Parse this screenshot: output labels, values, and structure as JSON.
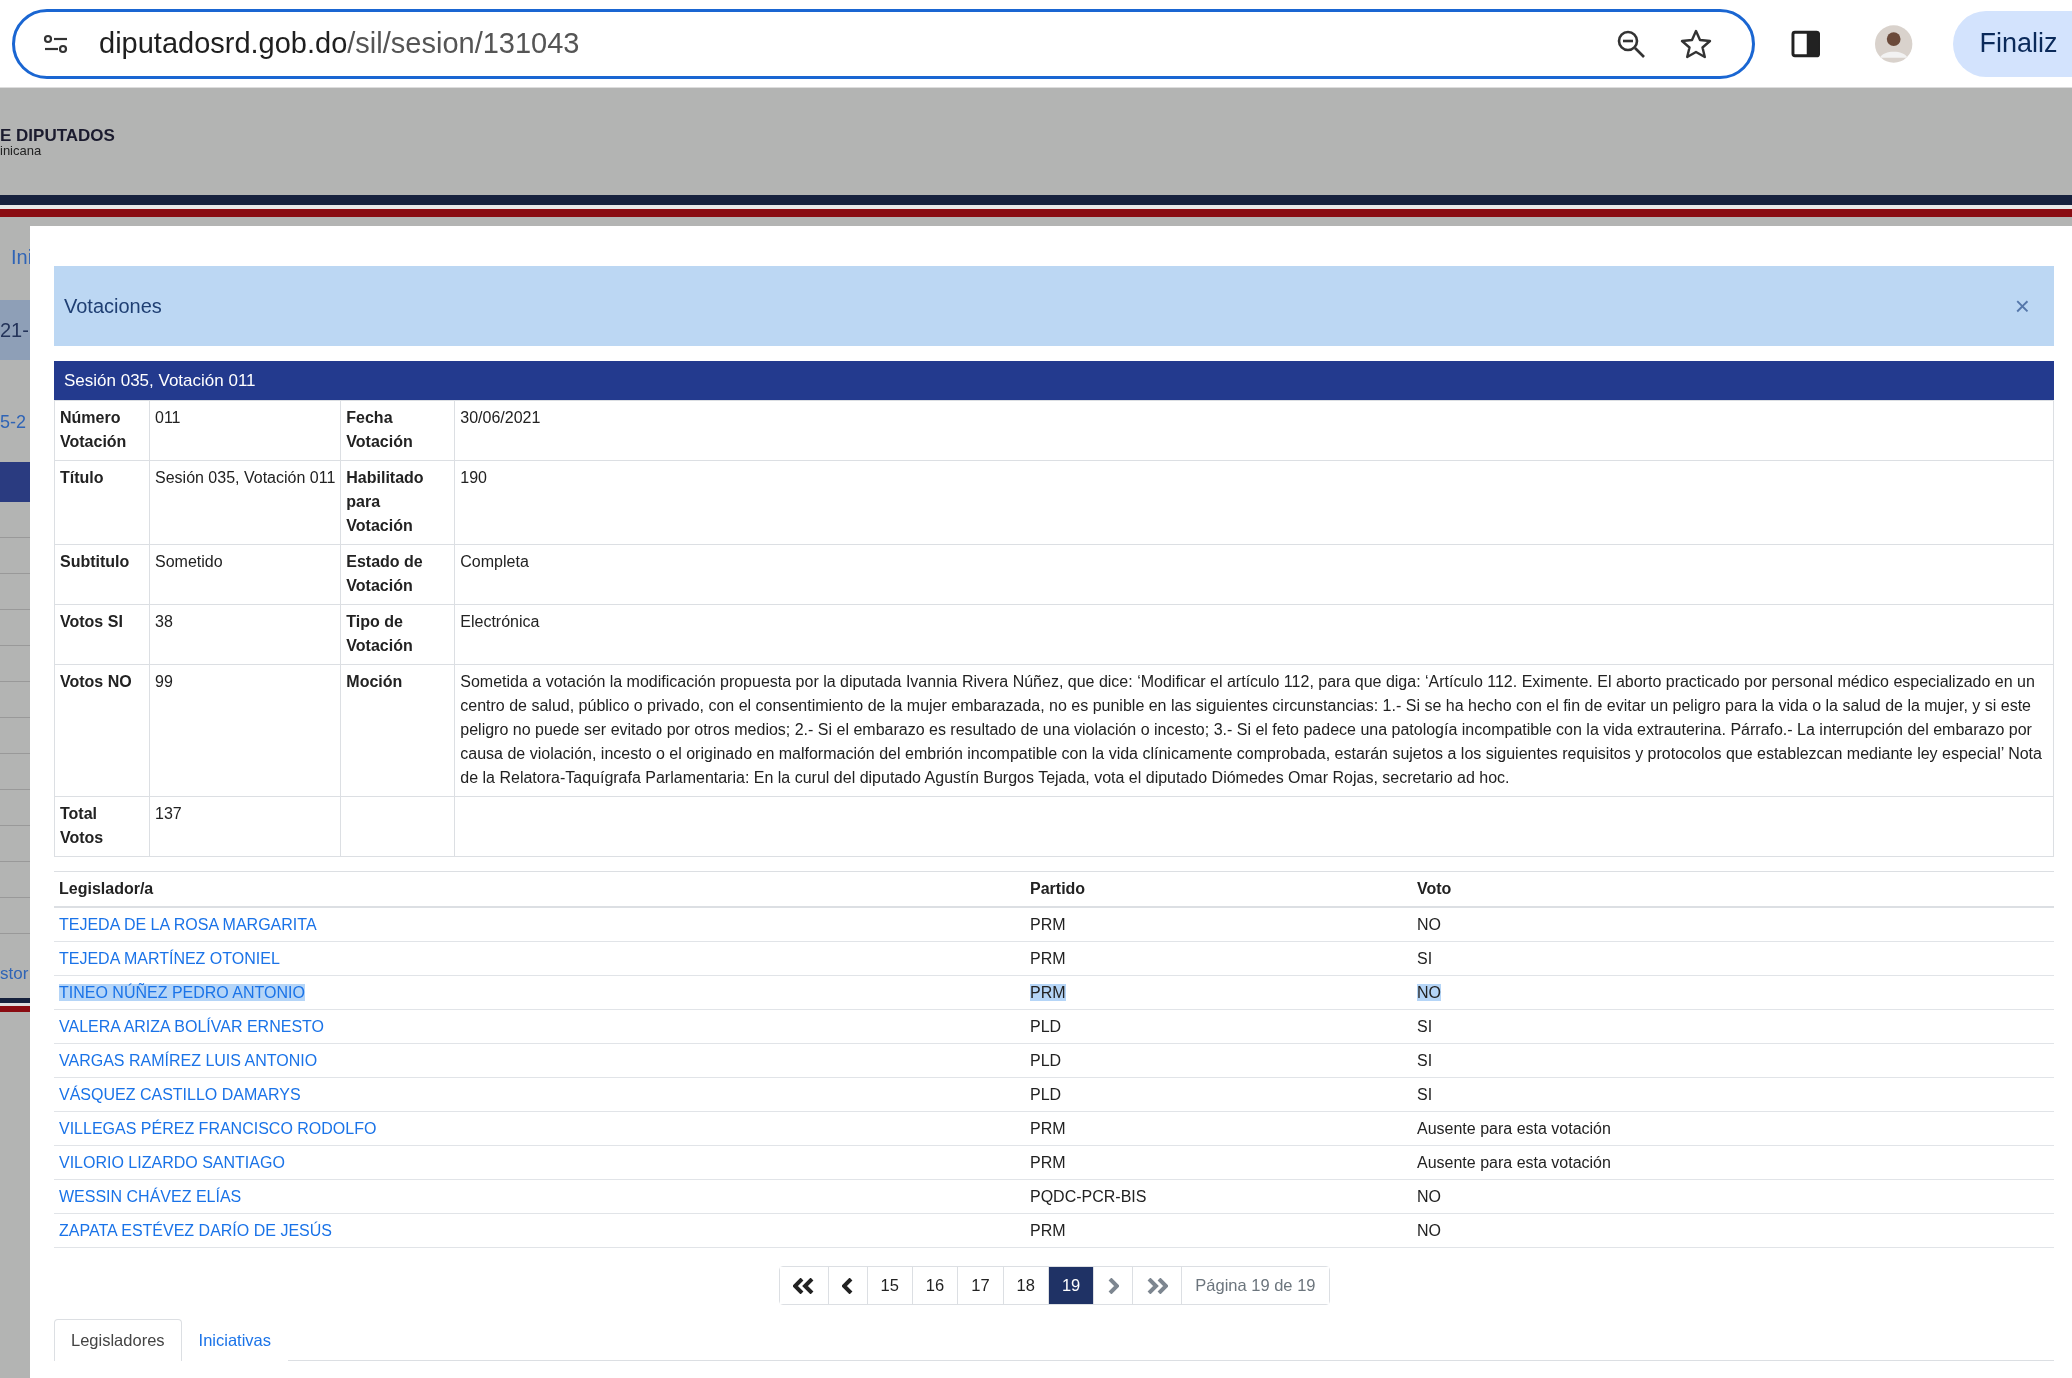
{
  "browser": {
    "url_host": "diputadosrd.gob.do",
    "url_path": "/sil/sesion/131043",
    "profile_button": "Finaliz"
  },
  "site_header": {
    "title": "E DIPUTADOS",
    "subtitle": "inicana"
  },
  "background_fragments": [
    "Ini",
    "21-",
    "5-2",
    "stor"
  ],
  "modal": {
    "title": "Votaciones",
    "close": "×",
    "section_title": "Sesión 035, Votación 011",
    "details": [
      {
        "label": "Número Votación",
        "value": "011",
        "label2": "Fecha Votación",
        "value2": "30/06/2021"
      },
      {
        "label": "Título",
        "value": "Sesión 035, Votación 011",
        "label2": "Habilitado para Votación",
        "value2": "190"
      },
      {
        "label": "Subtitulo",
        "value": "Sometido",
        "label2": "Estado de Votación",
        "value2": "Completa"
      },
      {
        "label": "Votos SI",
        "value": "38",
        "label2": "Tipo de Votación",
        "value2": "Electrónica"
      },
      {
        "label": "Votos NO",
        "value": "99",
        "label2": "Moción",
        "value2": "Sometida a votación la modificación propuesta por la diputada Ivannia Rivera Núñez, que dice: ‘Modificar el artículo 112, para que diga: ‘Artículo 112. Eximente. El aborto practicado por personal médico especializado en un centro de salud, público o privado, con el consentimiento de la mujer embarazada, no es punible en las siguientes circunstancias: 1.- Si se ha hecho con el fin de evitar un peligro para la vida o la salud de la mujer, y si este peligro no puede ser evitado por otros medios; 2.- Si el embarazo es resultado de una violación o incesto; 3.- Si el feto padece una patología incompatible con la vida extrauterina. Párrafo.- La interrupción del embarazo por causa de violación, incesto o el originado en malformación del embrión incompatible con la vida clínicamente comprobada, estarán sujetos a los siguientes requisitos y protocolos que establezcan mediante ley especial’ Nota de la Relatora-Taquígrafa Parlamentaria: En la curul del diputado Agustín Burgos Tejada, vota el diputado Diómedes Omar Rojas, secretario ad hoc."
      },
      {
        "label": "Total Votos",
        "value": "137"
      }
    ],
    "columns": [
      "Legislador/a",
      "Partido",
      "Voto"
    ],
    "rows": [
      {
        "name": "TEJEDA DE LA ROSA MARGARITA",
        "party": "PRM",
        "vote": "NO",
        "highlighted": false
      },
      {
        "name": "TEJEDA MARTÍNEZ OTONIEL",
        "party": "PRM",
        "vote": "SI",
        "highlighted": false
      },
      {
        "name": "TINEO NÚÑEZ PEDRO ANTONIO",
        "party": "PRM",
        "vote": "NO",
        "highlighted": true
      },
      {
        "name": "VALERA ARIZA BOLÍVAR ERNESTO",
        "party": "PLD",
        "vote": "SI",
        "highlighted": false
      },
      {
        "name": "VARGAS RAMÍREZ LUIS ANTONIO",
        "party": "PLD",
        "vote": "SI",
        "highlighted": false
      },
      {
        "name": "VÁSQUEZ CASTILLO DAMARYS",
        "party": "PLD",
        "vote": "SI",
        "highlighted": false
      },
      {
        "name": "VILLEGAS PÉREZ FRANCISCO RODOLFO",
        "party": "PRM",
        "vote": "Ausente para esta votación",
        "highlighted": false
      },
      {
        "name": "VILORIO LIZARDO SANTIAGO",
        "party": "PRM",
        "vote": "Ausente para esta votación",
        "highlighted": false
      },
      {
        "name": "WESSIN CHÁVEZ ELÍAS",
        "party": "PQDC-PCR-BIS",
        "vote": "NO",
        "highlighted": false
      },
      {
        "name": "ZAPATA ESTÉVEZ DARÍO DE JESÚS",
        "party": "PRM",
        "vote": "NO",
        "highlighted": false
      }
    ],
    "pagination": [
      {
        "kind": "first",
        "disabled": false
      },
      {
        "kind": "prev",
        "disabled": false
      },
      {
        "kind": "page",
        "label": "15",
        "selected": false
      },
      {
        "kind": "page",
        "label": "16",
        "selected": false
      },
      {
        "kind": "page",
        "label": "17",
        "selected": false
      },
      {
        "kind": "page",
        "label": "18",
        "selected": false
      },
      {
        "kind": "page",
        "label": "19",
        "selected": true
      },
      {
        "kind": "next",
        "disabled": true
      },
      {
        "kind": "last",
        "disabled": true
      },
      {
        "kind": "info",
        "label": "Página 19 de 19"
      }
    ],
    "tabs": [
      {
        "label": "Legisladores",
        "selected": true
      },
      {
        "label": "Iniciativas",
        "selected": false
      }
    ]
  }
}
